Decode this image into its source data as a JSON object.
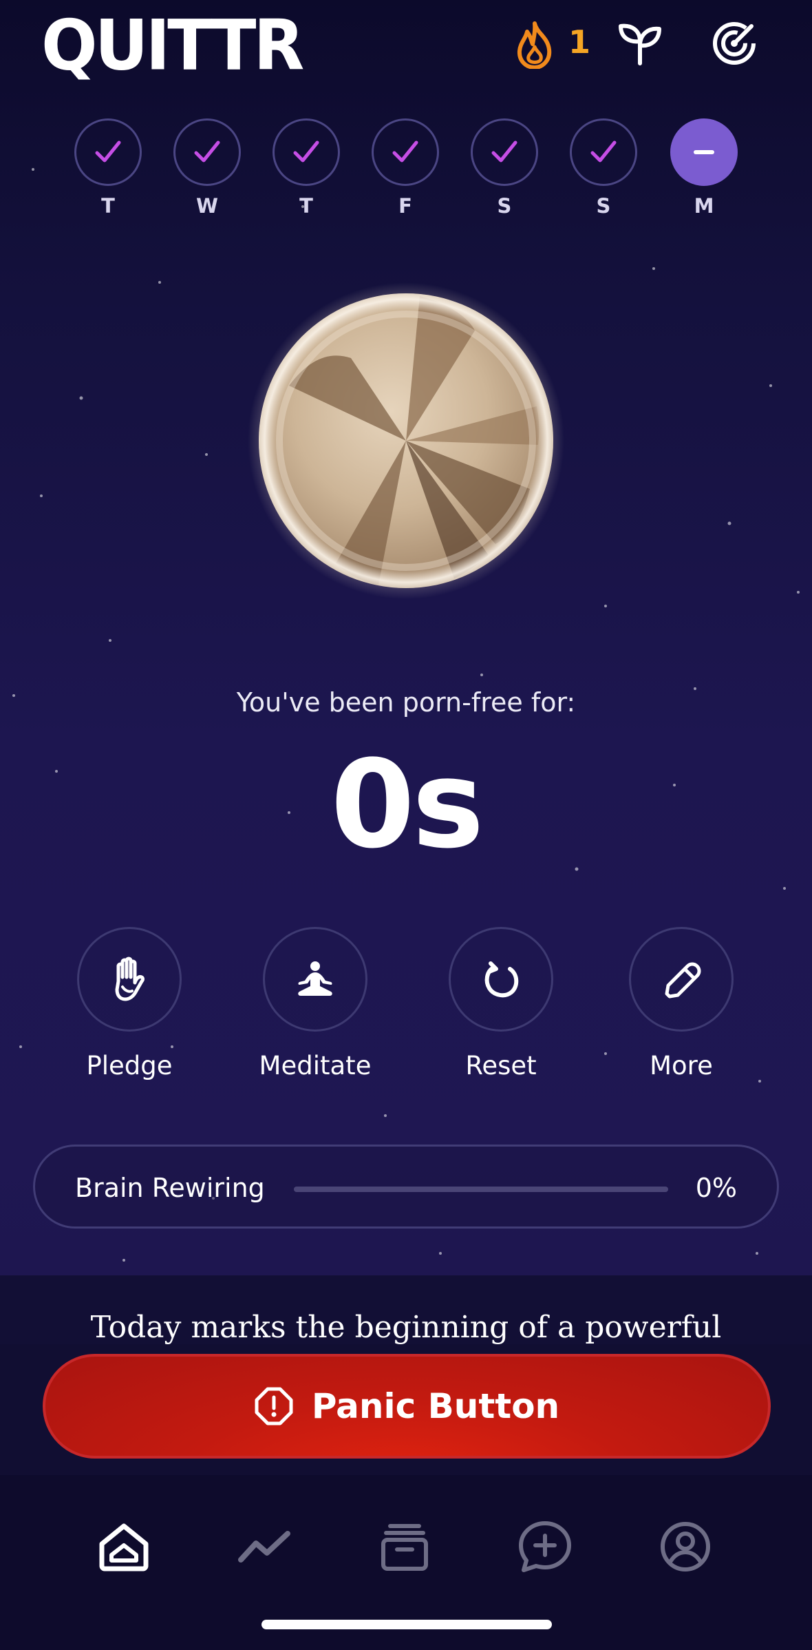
{
  "header": {
    "logo_text": "QUITTR",
    "streak_count": "1",
    "icons": [
      "flame-icon",
      "sprout-icon",
      "target-icon"
    ]
  },
  "week": {
    "days": [
      {
        "label": "T",
        "status": "done"
      },
      {
        "label": "W",
        "status": "done"
      },
      {
        "label": "T",
        "status": "done"
      },
      {
        "label": "F",
        "status": "done"
      },
      {
        "label": "S",
        "status": "done"
      },
      {
        "label": "S",
        "status": "done"
      },
      {
        "label": "M",
        "status": "current"
      }
    ]
  },
  "counter": {
    "caption": "You've been porn-free for:",
    "value": "0s"
  },
  "actions": [
    {
      "label": "Pledge",
      "icon": "hand-icon"
    },
    {
      "label": "Meditate",
      "icon": "meditate-icon"
    },
    {
      "label": "Reset",
      "icon": "reset-icon"
    },
    {
      "label": "More",
      "icon": "pencil-icon"
    }
  ],
  "progress": {
    "label": "Brain Rewiring",
    "percent_text": "0%",
    "value": 0
  },
  "quote": {
    "text": "Today marks the beginning of a powerful"
  },
  "panic": {
    "label": "Panic Button",
    "icon": "alert-icon"
  },
  "tabbar": {
    "tabs": [
      "home-icon",
      "chart-icon",
      "library-icon",
      "chat-add-icon",
      "profile-icon"
    ],
    "active": 0
  },
  "colors": {
    "accent_purple": "#7b5cd0",
    "check_purple": "#c64ee6",
    "streak_orange": "#f5a524",
    "panic_red": "#c31a10"
  }
}
